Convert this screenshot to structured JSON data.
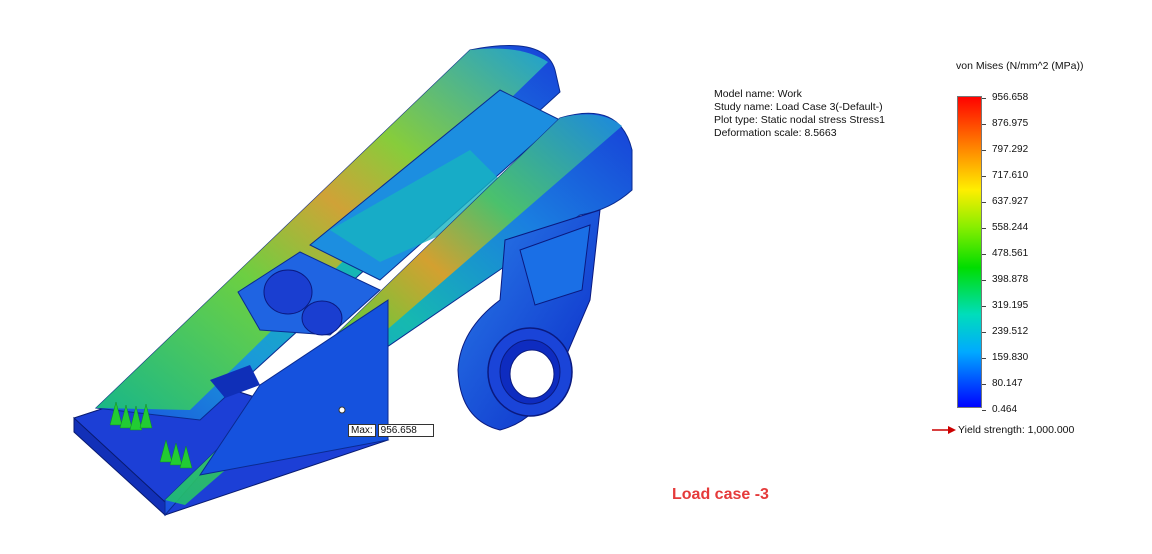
{
  "model_info": {
    "model_name": "Model name: Work",
    "study_name": "Study name: Load Case 3(-Default-)",
    "plot_type": "Plot type: Static nodal stress Stress1",
    "deformation_scale": "Deformation scale: 8.5663"
  },
  "legend": {
    "title": "von Mises (N/mm^2 (MPa))",
    "ticks": [
      "956.658",
      "876.975",
      "797.292",
      "717.610",
      "637.927",
      "558.244",
      "478.561",
      "398.878",
      "319.195",
      "239.512",
      "159.830",
      "80.147",
      "0.464"
    ],
    "yield_label": "Yield strength: 1,000.000"
  },
  "max_marker": {
    "label": "Max:",
    "value": "956.658"
  },
  "caption": "Load case -3",
  "colors": {
    "high": "#ff0000",
    "mid_high": "#ffcc00",
    "mid": "#00dd00",
    "mid_low": "#00cccc",
    "low": "#0000ff",
    "caption": "#e53a3a",
    "yield_arrow": "#cc0000"
  }
}
